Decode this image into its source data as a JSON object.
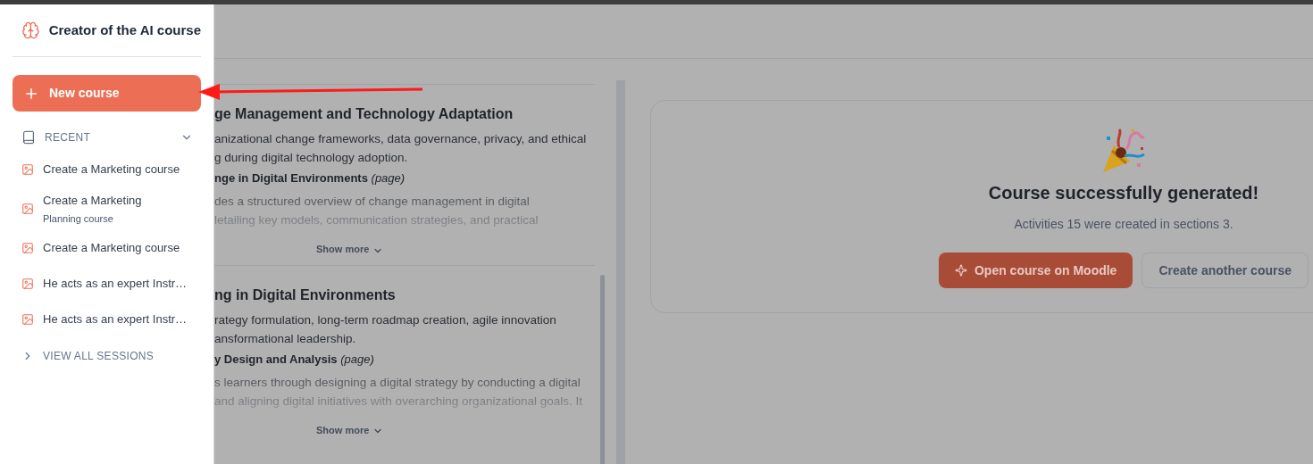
{
  "sidebar": {
    "title": "Creator of the AI course",
    "new_course_button": "New course",
    "recent": {
      "label": "RECENT",
      "expanded": true
    },
    "items": [
      {
        "title": "Create a Marketing course"
      },
      {
        "title": "Create a Marketing",
        "subtitle": "Planning course"
      },
      {
        "title": "Create a Marketing course"
      },
      {
        "title": "He acts as an expert Instr…"
      },
      {
        "title": "He acts as an expert Instr…"
      }
    ],
    "view_all": "VIEW ALL SESSIONS"
  },
  "sections": [
    {
      "title": "ge Management and Technology Adaptation",
      "summary_lines": [
        "anizational change frameworks, data governance, privacy, and ethical",
        "g during digital technology adoption."
      ],
      "activity": "**nge in Digital Environments** *(page)*",
      "activity_lines": [
        "des a structured overview of change management in digital",
        "letailing key models, communication strategies, and practical"
      ],
      "show_more": "Show more"
    },
    {
      "title": "ng in Digital Environments",
      "summary_lines": [
        "rategy formulation, long-term roadmap creation, agile innovation",
        "ansformational leadership."
      ],
      "activity": "**y Design and Analysis** *(page)*",
      "activity_lines": [
        "s learners through designing a digital strategy by conducting a digital",
        "and aligning digital initiatives with overarching organizational goals. It"
      ],
      "show_more": "Show more"
    }
  ],
  "result": {
    "title": "Course successfully generated!",
    "message": "Activities 15 were created in sections 3.",
    "primary_button": "Open course on Moodle",
    "secondary_button": "Create another course"
  }
}
